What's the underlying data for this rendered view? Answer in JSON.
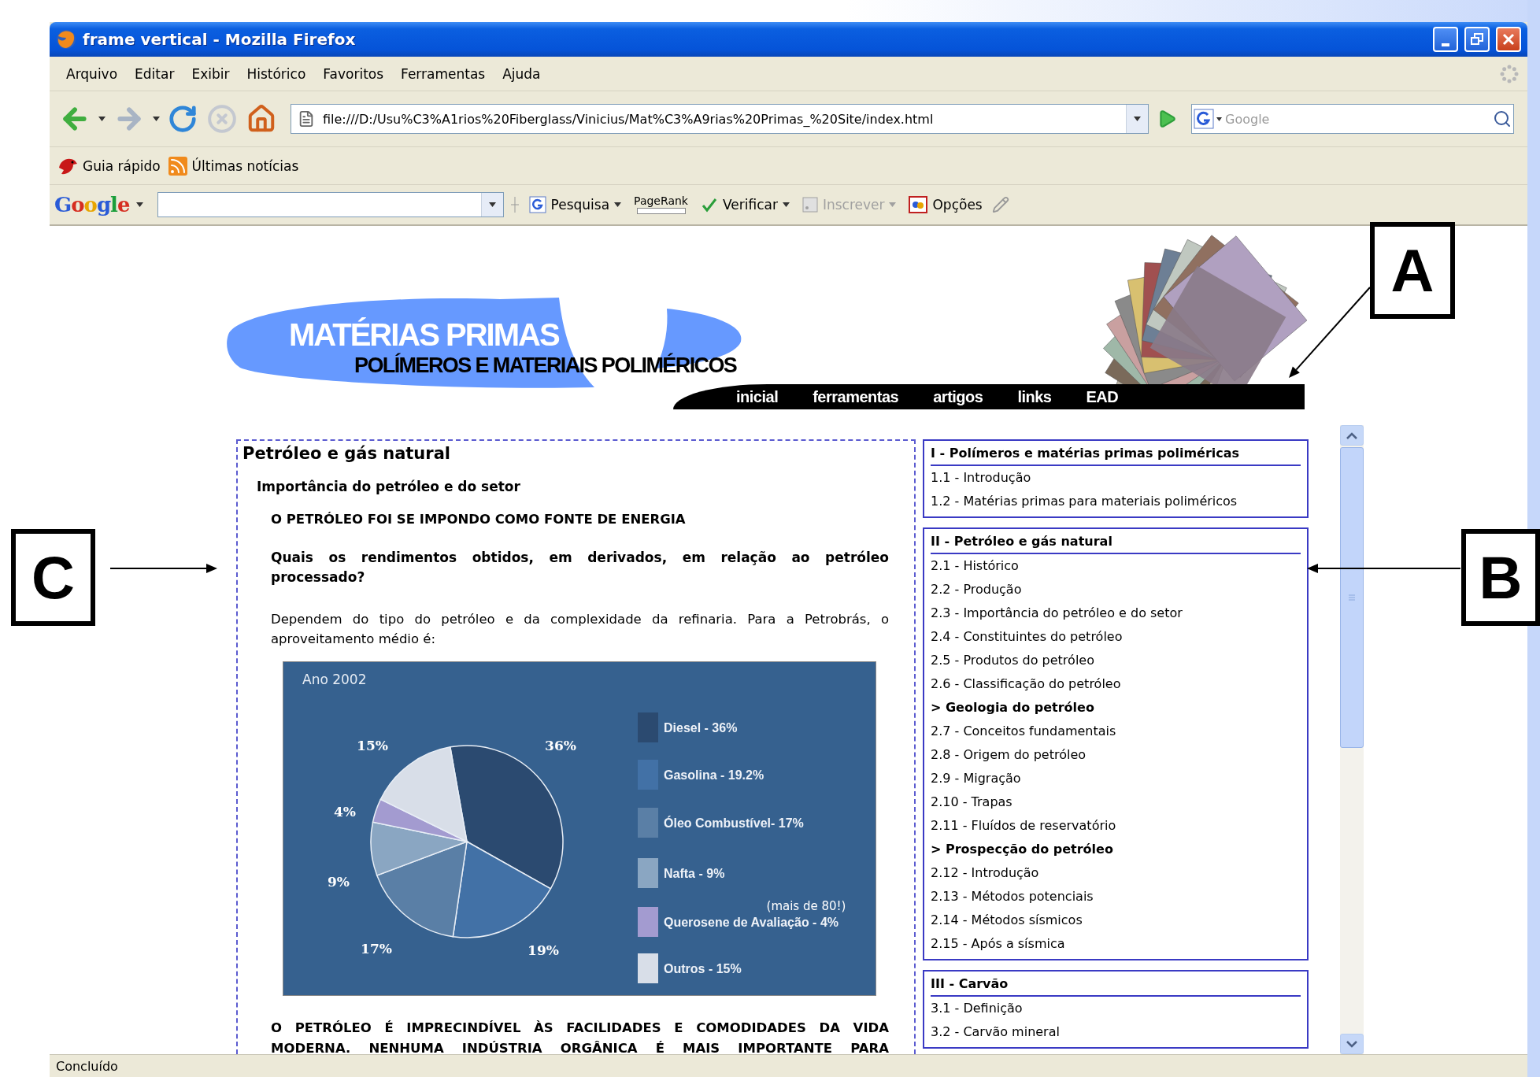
{
  "window": {
    "title": "frame vertical - Mozilla Firefox"
  },
  "menu": [
    "Arquivo",
    "Editar",
    "Exibir",
    "Histórico",
    "Favoritos",
    "Ferramentas",
    "Ajuda"
  ],
  "navigation": {
    "url": "file:///D:/Usu%C3%A1rios%20Fiberglass/Vinicius/Mat%C3%A9rias%20Primas_%20Site/index.html",
    "search_placeholder": "Google"
  },
  "bookmarks": [
    {
      "kind": "bird",
      "label": "Guia rápido"
    },
    {
      "kind": "feed",
      "label": "Últimas notícias"
    }
  ],
  "google_toolbar": {
    "logo": "Google",
    "items": [
      {
        "kind": "search",
        "label": "Pesquisa",
        "menu": true,
        "disabled": false
      },
      {
        "kind": "pagerank",
        "label": "PageRank",
        "menu": false,
        "disabled": false
      },
      {
        "kind": "spellcheck",
        "label": "Verificar",
        "menu": true,
        "disabled": false
      },
      {
        "kind": "subscribe",
        "label": "Inscrever",
        "menu": true,
        "disabled": true
      },
      {
        "kind": "options",
        "label": "Opções",
        "menu": false,
        "disabled": false
      }
    ]
  },
  "banner": {
    "title": "MATÉRIAS PRIMAS",
    "subtitle": "POLÍMEROS E MATERIAIS POLIMÉRICOS",
    "nav": [
      "inicial",
      "ferramentas",
      "artigos",
      "links",
      "EAD"
    ]
  },
  "article": {
    "title": "Petróleo e gás natural",
    "subtitle": "Importância do petróleo e do setor",
    "heading": "O PETRÓLEO FOI SE IMPONDO COMO FONTE DE ENERGIA",
    "question": "Quais os rendimentos obtidos, em derivados, em relação ao petróleo processado?",
    "body": "Dependem do tipo do petróleo e da complexidade da refinaria. Para a Petrobrás, o aproveitamento médio é:",
    "chart_data": {
      "type": "pie",
      "title": "Ano 2002",
      "categories": [
        "Diesel - 36%",
        "Gasolina - 19.2%",
        "Óleo Combustível- 17%",
        "Nafta - 9%",
        "Querosene de Avaliação - 4%",
        "Outros - 15%"
      ],
      "values": [
        36,
        19.2,
        17,
        9,
        4,
        15
      ],
      "value_labels": [
        "36%",
        "19%",
        "17%",
        "9%",
        "4%",
        "15%"
      ],
      "annotations": [
        "(mais de 80!)"
      ],
      "legend": "right"
    },
    "closing": "O PETRÓLEO É IMPRECINDÍVEL ÀS FACILIDADES E COMODIDADES DA VIDA MODERNA. NENHUMA INDÚSTRIA ORGÂNICA É MAIS IMPORTANTE PARA"
  },
  "sidebar": {
    "sections": [
      {
        "title": "I - Polímeros e matérias primas poliméricas",
        "items": [
          {
            "kind": "link",
            "label": "1.1 - Introdução"
          },
          {
            "kind": "link",
            "label": "1.2 - Matérias primas para materiais poliméricos"
          }
        ]
      },
      {
        "title": "II - Petróleo e gás natural",
        "items": [
          {
            "kind": "link",
            "label": "2.1 - Histórico"
          },
          {
            "kind": "link",
            "label": "2.2 - Produção"
          },
          {
            "kind": "link",
            "label": "2.3 - Importância do petróleo e do setor"
          },
          {
            "kind": "link",
            "label": "2.4 - Constituintes do petróleo"
          },
          {
            "kind": "link",
            "label": "2.5 - Produtos do petróleo"
          },
          {
            "kind": "link",
            "label": "2.6 - Classificação do petróleo"
          },
          {
            "kind": "group",
            "label": "> Geologia do petróleo"
          },
          {
            "kind": "link",
            "label": "2.7 - Conceitos fundamentais"
          },
          {
            "kind": "link",
            "label": "2.8 - Origem do petróleo"
          },
          {
            "kind": "link",
            "label": "2.9 - Migração"
          },
          {
            "kind": "link",
            "label": "2.10 - Trapas"
          },
          {
            "kind": "link",
            "label": "2.11 - Fluídos de reservatório"
          },
          {
            "kind": "group",
            "label": "> Prospecção do petróleo"
          },
          {
            "kind": "link",
            "label": "2.12 - Introdução"
          },
          {
            "kind": "link",
            "label": "2.13 - Métodos potenciais"
          },
          {
            "kind": "link",
            "label": "2.14 - Métodos sísmicos"
          },
          {
            "kind": "link",
            "label": "2.15 - Após a sísmica"
          }
        ]
      },
      {
        "title": "III - Carvão",
        "items": [
          {
            "kind": "link",
            "label": "3.1 - Definição"
          },
          {
            "kind": "link",
            "label": "3.2 - Carvão mineral"
          }
        ]
      }
    ]
  },
  "status_bar": "Concluído",
  "annotations": [
    {
      "label": "A"
    },
    {
      "label": "B"
    },
    {
      "label": "C"
    }
  ]
}
